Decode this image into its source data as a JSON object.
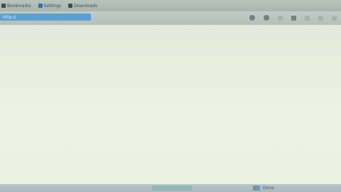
{
  "tabs": [
    {
      "label": "Bookmarks",
      "icon": "bookmark-icon",
      "color": "#3f4b57"
    },
    {
      "label": "Settings",
      "icon": "settings-icon",
      "color": "#2f6fb0"
    },
    {
      "label": "Downloads",
      "icon": "download-icon",
      "color": "#3f4b57"
    }
  ],
  "address_bar": {
    "value": "http://"
  },
  "toolbar_icons": [
    "reload-icon",
    "home-icon",
    "back-icon",
    "forward-icon",
    "menu-icon",
    "more-icon",
    "close-icon"
  ],
  "statusbar": {
    "left_text": "",
    "right_text": "Done"
  },
  "colors": {
    "accent": "#5aa0d4",
    "content_bg": "#e7eedf"
  }
}
